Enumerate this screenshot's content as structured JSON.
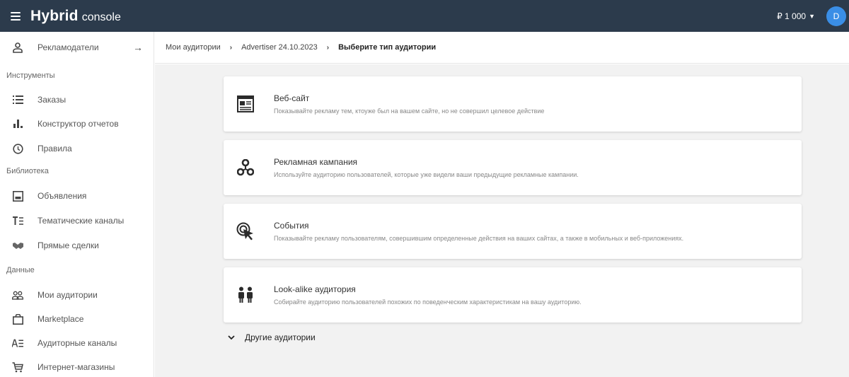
{
  "header": {
    "logo_main": "Hybrid",
    "logo_sub": "console",
    "balance": "₽ 1 000",
    "avatar_initial": "D"
  },
  "sidebar": {
    "advertisers": "Рекламодатели",
    "sections": {
      "tools": "Инструменты",
      "library": "Библиотека",
      "data": "Данные"
    },
    "items": {
      "orders": "Заказы",
      "report_builder": "Конструктор отчетов",
      "rules": "Правила",
      "ads": "Объявления",
      "thematic_channels": "Тематические каналы",
      "direct_deals": "Прямые сделки",
      "my_audiences": "Мои аудитории",
      "marketplace": "Marketplace",
      "audience_channels": "Аудиторные каналы",
      "online_stores": "Интернет-магазины"
    }
  },
  "breadcrumb": {
    "level1": "Мои аудитории",
    "level2": "Advertiser 24.10.2023",
    "current": "Выберите тип аудитории"
  },
  "cards": [
    {
      "icon": "website-icon",
      "title": "Веб-сайт",
      "description": "Показывайте рекламу тем, ктоуже был на вашем сайте, но не совершил целевое действие"
    },
    {
      "icon": "campaign-icon",
      "title": "Рекламная кампания",
      "description": "Используйте аудиторию пользователей, которые уже видели ваши предыдущие рекламные кампании."
    },
    {
      "icon": "cursor-click-icon",
      "title": "События",
      "description": "Показывайте рекламу пользователям, совершившим определенные действия на ваших сайтах, а также в мобильных и веб-приложениях."
    },
    {
      "icon": "lookalike-icon",
      "title": "Look-alike аудитория",
      "description": "Собирайте аудиторию пользователей похожих по поведенческим характеристикам на вашу аудиторию."
    }
  ],
  "other_audiences": "Другие аудитории",
  "colors": {
    "topbar": "#2c3b4c",
    "main_bg": "#f2f2f2",
    "avatar": "#3a8ee6"
  }
}
